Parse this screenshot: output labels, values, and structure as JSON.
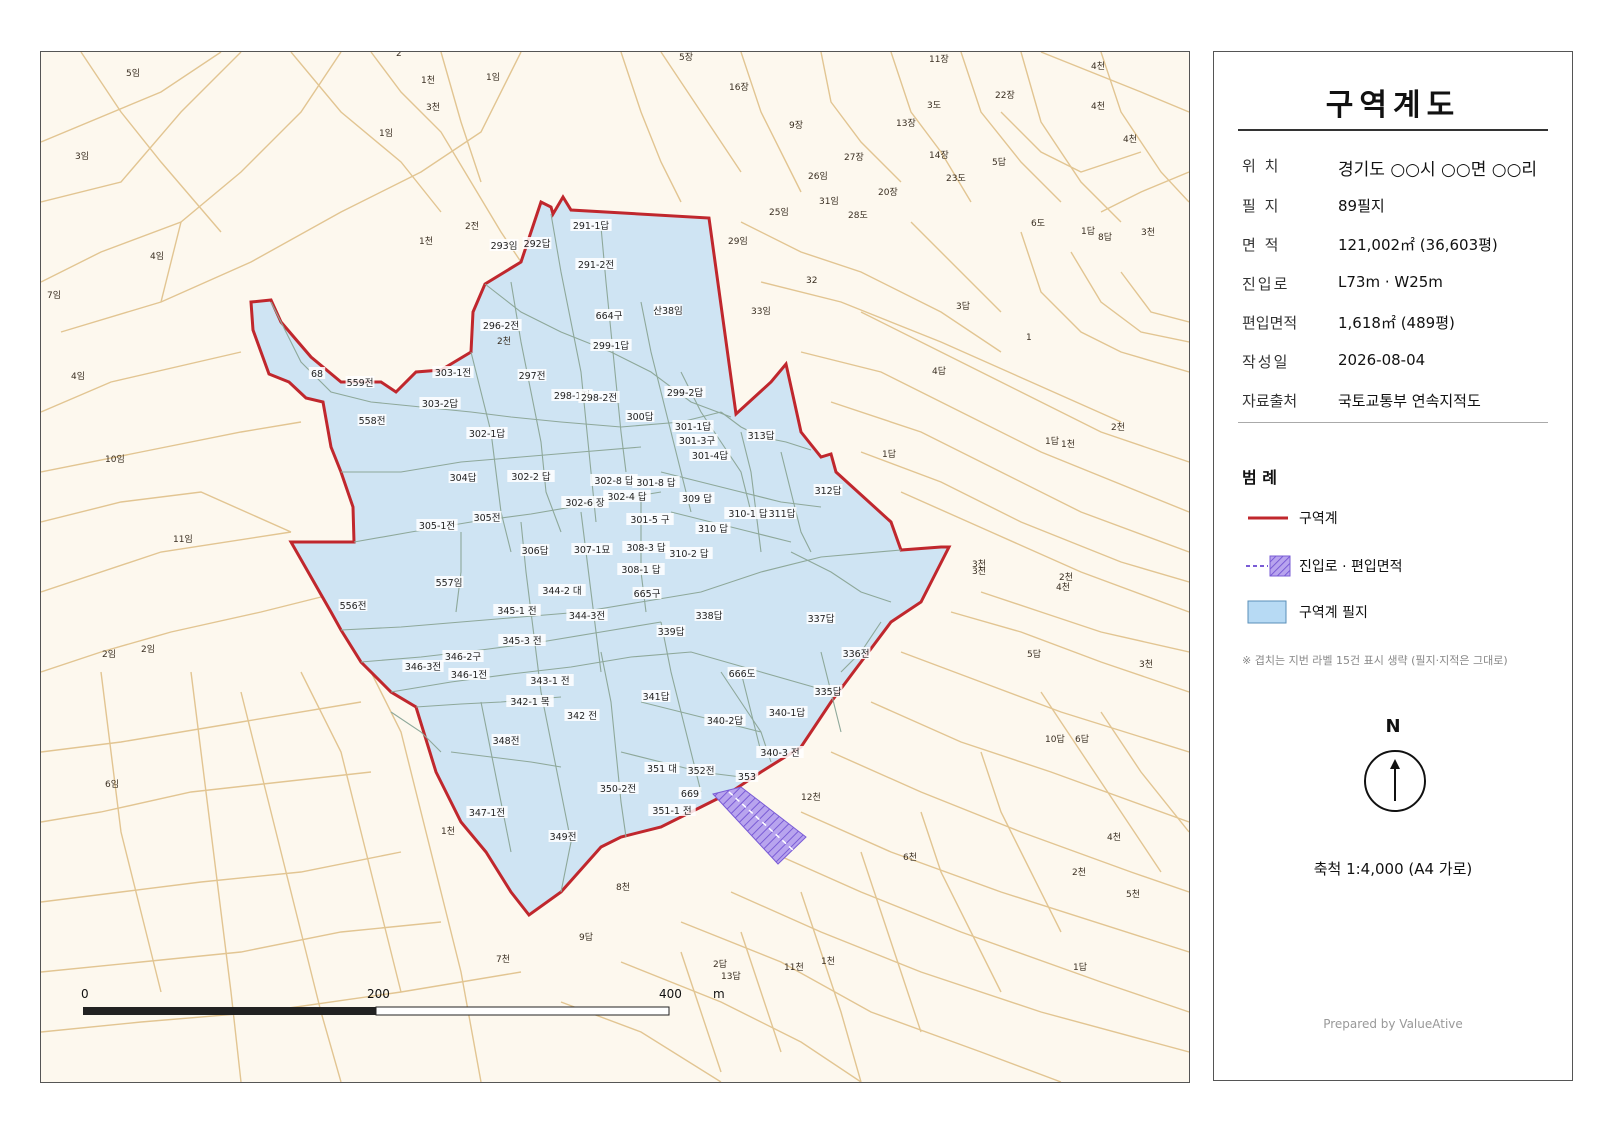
{
  "panel": {
    "title": "구역계도",
    "rows": [
      {
        "key": "위 치",
        "value": "경기도 ○○시 ○○면 ○○리"
      },
      {
        "key": "필 지",
        "value": "89필지"
      },
      {
        "key": "면 적",
        "value": "121,002㎡ (36,603평)"
      },
      {
        "key": "진입로",
        "value": "L73m · W25m"
      },
      {
        "key": "편입면적",
        "value": "1,618㎡ (489평)"
      },
      {
        "key": "작성일",
        "value": "2026-08-04"
      },
      {
        "key": "자료출처",
        "value": "국토교통부 연속지적도"
      }
    ],
    "legend_title": "범 례",
    "legend": [
      {
        "label": "구역계",
        "color": "#c0272d"
      },
      {
        "label": "진입로 · 편입면적",
        "color": "#8a6be0"
      },
      {
        "label": "구역계 필지",
        "color": "#b7daf4"
      }
    ],
    "note": "※ 겹치는 지번 라벨 15건 표시 생략 (필지·지적은 그대로)",
    "north": "N",
    "scale": "축척 1:4,000 (A4 가로)",
    "prepared_by": "Prepared by ValueAtive"
  },
  "map": {
    "colors": {
      "parcel_line": "#e2c592",
      "boundary": "#c0272d",
      "district_fill": "#cfe4f3",
      "inner_line": "#8ea89a",
      "access": "#8a6be0"
    },
    "scale_bar": {
      "ticks": [
        "0",
        "200",
        "400"
      ],
      "unit": "m"
    },
    "district_labels": [
      "291-1답",
      "293임",
      "292답",
      "291-2전",
      "296-2전",
      "664구",
      "산38임",
      "299-1답",
      "303-1전",
      "297전",
      "68",
      "559전",
      "303-2답",
      "298-1전",
      "298-2전",
      "299-2답",
      "558전",
      "300답",
      "301-1답",
      "301-3구",
      "313답",
      "302-1답",
      "301-4답",
      "304답",
      "302-2 답",
      "302-8 답",
      "301-8 답",
      "302-4 답",
      "309 답",
      "312답",
      "302-6 장",
      "310-1 답",
      "311답",
      "305-1전",
      "305전",
      "301-5 구",
      "310 답",
      "306답",
      "307-1묘",
      "308-3 답",
      "310-2 답",
      "557임",
      "308-1 답",
      "556전",
      "344-2 대",
      "665구",
      "345-1 전",
      "344-3전",
      "338답",
      "337답",
      "339답",
      "345-3 전",
      "346-2구",
      "336전",
      "346-3전",
      "346-1전",
      "666도",
      "343-1 전",
      "341답",
      "335답",
      "342-1 목",
      "342 전",
      "340-1답",
      "340-2답",
      "348전",
      "340-3 전",
      "351 대",
      "352전",
      "350-2전",
      "353",
      "669",
      "347-1전",
      "351-1 전",
      "349전"
    ],
    "bg_labels": [
      "5임",
      "2",
      "1천",
      "1임",
      "3천",
      "5장",
      "16장",
      "11장",
      "4천",
      "22장",
      "3임",
      "1임",
      "9장",
      "13장",
      "3도",
      "4천",
      "27장",
      "14장",
      "5답",
      "26임",
      "4임",
      "25임",
      "31임",
      "20장",
      "23도",
      "2전",
      "29임",
      "28도",
      "1답",
      "6도",
      "4천",
      "8답",
      "3천",
      "7임",
      "2천",
      "32",
      "3답",
      "1천",
      "33임",
      "4임",
      "1",
      "4답",
      "10임",
      "11임",
      "1천",
      "1답",
      "2천",
      "3천",
      "4천",
      "3천",
      "2임",
      "5답",
      "1답",
      "2임",
      "6임",
      "1천",
      "7천",
      "8천",
      "12천",
      "3천",
      "2답",
      "1천",
      "2천",
      "6천",
      "9답",
      "10답",
      "6답",
      "11천",
      "2천",
      "1답",
      "4천",
      "13답",
      "5천"
    ]
  }
}
